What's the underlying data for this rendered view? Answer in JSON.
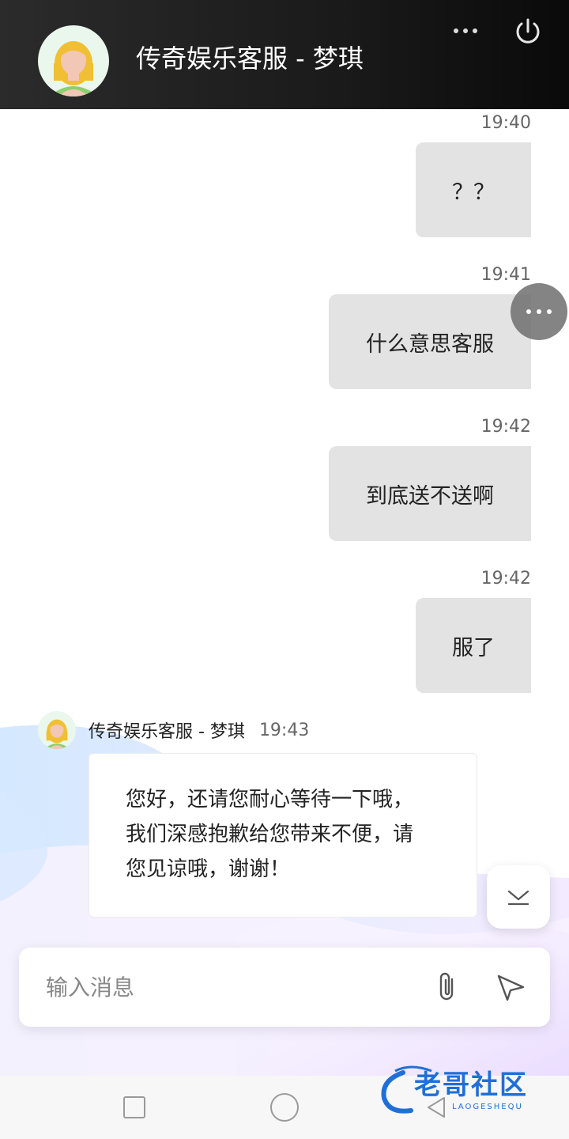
{
  "header": {
    "title": "传奇娱乐客服 - 梦琪",
    "more_icon": "more-horizontal-icon",
    "power_icon": "power-icon",
    "background": "#1e1e1e"
  },
  "messages_out": [
    {
      "time": "19:40",
      "text": "？？"
    },
    {
      "time": "19:41",
      "text": "什么意思客服"
    },
    {
      "time": "19:42",
      "text": "到底送不送啊"
    },
    {
      "time": "19:42",
      "text": "服了"
    }
  ],
  "message_in": {
    "sender": "传奇娱乐客服 - 梦琪",
    "time": "19:43",
    "lines": [
      "您好，还请您耐心等待一下哦，",
      "我们深感抱歉给您带来不便，请",
      "您见谅哦，谢谢！"
    ]
  },
  "input": {
    "placeholder": "输入消息",
    "attach_icon": "paperclip-icon",
    "send_icon": "send-icon"
  },
  "floating": {
    "more_icon": "more-horizontal-icon",
    "scroll_icon": "chevron-down-icon"
  },
  "navbar": {
    "recent_icon": "square-icon",
    "home_icon": "circle-icon",
    "back_icon": "triangle-back-icon"
  },
  "watermark": {
    "text": "老哥社区",
    "subtext": "LAOGESHEQU"
  },
  "colors": {
    "bubble_out": "#e3e3e3",
    "bubble_in": "#ffffff",
    "accent": "#1f6fd8"
  }
}
